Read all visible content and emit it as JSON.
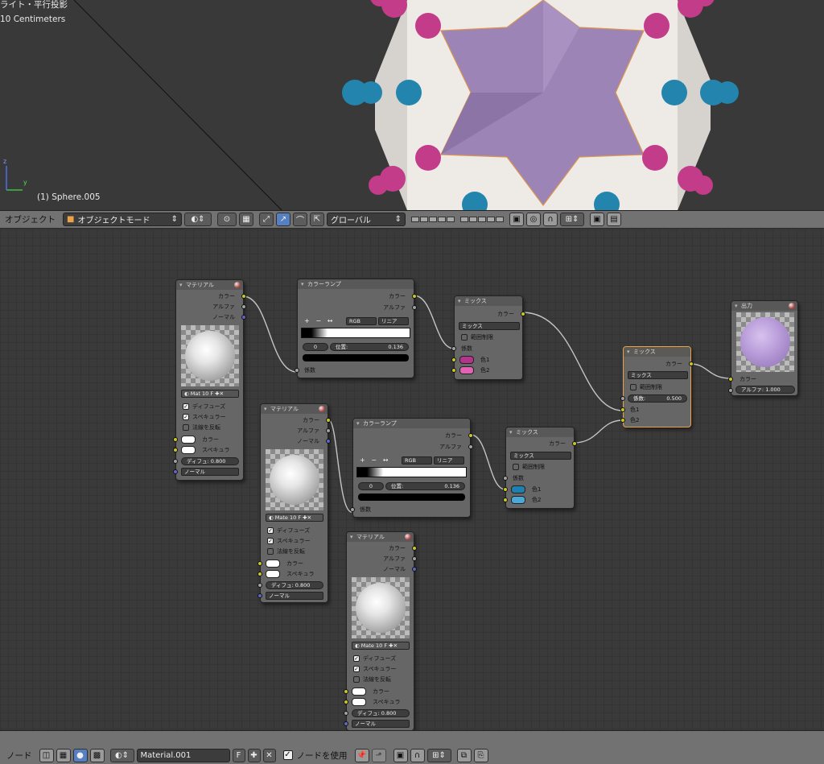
{
  "viewport": {
    "view_label": "ライト・平行投影",
    "units_label": "10 Centimeters",
    "object_label": "(1) Sphere.005",
    "axis_y": "y",
    "axis_z": "z"
  },
  "view_toolbar": {
    "object_menu": "オブジェクト",
    "mode": "オブジェクトモード",
    "orientation": "グローバル"
  },
  "nodes": {
    "material1": {
      "title": "マテリアル",
      "out_color": "カラー",
      "out_alpha": "アルファ",
      "out_normal": "ノーマル",
      "mat_name": "Mat",
      "mat_users": "10",
      "mat_f": "F",
      "diffuse": "ディフューズ",
      "specular": "スペキュラー",
      "invert_normal": "法線を反転",
      "in_color": "カラー",
      "in_spec": "スペキュラ",
      "diffuse_field": "ディフュ: 0.800",
      "normal_dropdown": "ノーマル"
    },
    "material2": {
      "title": "マテリアル",
      "out_color": "カラー",
      "out_alpha": "アルファ",
      "out_normal": "ノーマル",
      "mat_name": "Mate",
      "mat_users": "10",
      "mat_f": "F",
      "diffuse": "ディフューズ",
      "specular": "スペキュラー",
      "invert_normal": "法線を反転",
      "in_color": "カラー",
      "in_spec": "スペキュラ",
      "diffuse_field": "ディフュ: 0.800",
      "normal_dropdown": "ノーマル"
    },
    "material3": {
      "title": "マテリアル",
      "out_color": "カラー",
      "out_alpha": "アルファ",
      "out_normal": "ノーマル",
      "mat_name": "Mate",
      "mat_users": "10",
      "mat_f": "F",
      "diffuse": "ディフューズ",
      "specular": "スペキュラー",
      "invert_normal": "法線を反転",
      "in_color": "カラー",
      "in_spec": "スペキュラ",
      "diffuse_field": "ディフュ: 0.800",
      "normal_dropdown": "ノーマル"
    },
    "ramp1": {
      "title": "カラーランプ",
      "out_color": "カラー",
      "out_alpha": "アルファ",
      "mode": "RGB",
      "interp": "リニア",
      "index": "0",
      "pos_label": "位置:",
      "pos_value": "0.136",
      "in_fac": "係数",
      "plus": "+",
      "minus": "−",
      "flip": "↔"
    },
    "ramp2": {
      "title": "カラーランプ",
      "out_color": "カラー",
      "out_alpha": "アルファ",
      "mode": "RGB",
      "interp": "リニア",
      "index": "0",
      "pos_label": "位置:",
      "pos_value": "0.136",
      "in_fac": "係数",
      "plus": "+",
      "minus": "−",
      "flip": "↔"
    },
    "mix1": {
      "title": "ミックス",
      "out_color": "カラー",
      "blend": "ミックス",
      "clamp": "範囲制限",
      "fac": "係数",
      "color1": "色1",
      "color2": "色2",
      "swatch1": "#b4348c",
      "swatch2": "#e163b4"
    },
    "mix2": {
      "title": "ミックス",
      "out_color": "カラー",
      "blend": "ミックス",
      "clamp": "範囲制限",
      "fac": "係数",
      "color1": "色1",
      "color2": "色2",
      "swatch1": "#1f7fae",
      "swatch2": "#4aa8d8"
    },
    "mix3": {
      "title": "ミックス",
      "out_color": "カラー",
      "blend": "ミックス",
      "clamp": "範囲制限",
      "fac_field": "係数:",
      "fac_value": "0.500",
      "color1": "色1",
      "color2": "色2"
    },
    "output": {
      "title": "出力",
      "in_color": "カラー",
      "alpha_field": "アルファ: 1.000"
    }
  },
  "node_toolbar": {
    "node_menu": "ノード",
    "material_name": "Material.001",
    "fake_user": "F",
    "use_nodes": "ノードを使用"
  },
  "colors": {
    "accent_blue": "#5680c2",
    "selected_orange": "#e8a34a",
    "socket_yellow": "#c7c729",
    "socket_gray": "#a1a1a1",
    "socket_blue": "#6363c7"
  }
}
